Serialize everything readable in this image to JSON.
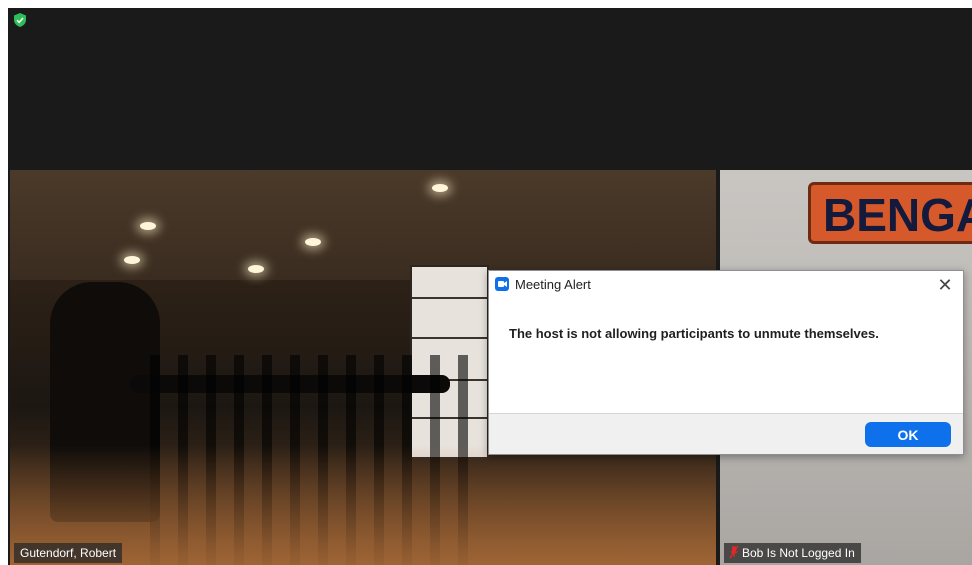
{
  "meeting": {
    "shield_icon": "green-shield-icon"
  },
  "participants": [
    {
      "name": "Gutendorf, Robert"
    },
    {
      "name": "Bob Is Not Logged In",
      "mic_icon": "muted-mic-icon"
    }
  ],
  "video_background_text": {
    "sign_text": "BENGAL"
  },
  "dialog": {
    "app_icon": "zoom-icon",
    "title": "Meeting Alert",
    "message": "The host is not allowing participants to unmute themselves.",
    "ok_label": "OK",
    "close_icon": "close-icon"
  },
  "colors": {
    "accent_blue": "#0e71eb",
    "shield_green": "#2ebd59",
    "mute_red": "#e02828"
  }
}
